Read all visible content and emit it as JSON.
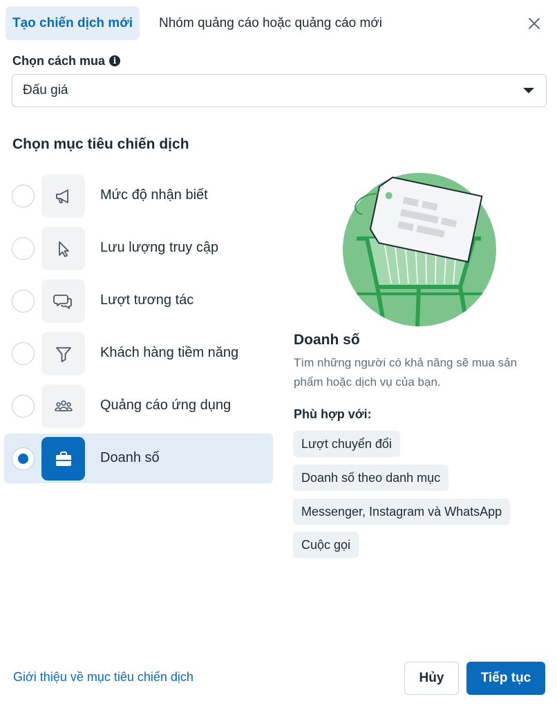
{
  "header": {
    "tabs": [
      {
        "label": "Tạo chiến dịch mới",
        "active": true
      },
      {
        "label": "Nhóm quảng cáo hoặc quảng cáo mới",
        "active": false
      }
    ],
    "close_icon": "close-icon"
  },
  "buying_type": {
    "label": "Chọn cách mua",
    "info_icon": "info-icon",
    "selected_value": "Đấu giá"
  },
  "objectives": {
    "heading": "Chọn mục tiêu chiến dịch",
    "items": [
      {
        "label": "Mức độ nhận biết",
        "icon": "megaphone-icon",
        "selected": false
      },
      {
        "label": "Lưu lượng truy cập",
        "icon": "cursor-icon",
        "selected": false
      },
      {
        "label": "Lượt tương tác",
        "icon": "chat-bubbles-icon",
        "selected": false
      },
      {
        "label": "Khách hàng tiềm năng",
        "icon": "funnel-icon",
        "selected": false
      },
      {
        "label": "Quảng cáo ứng dụng",
        "icon": "people-group-icon",
        "selected": false
      },
      {
        "label": "Doanh số",
        "icon": "shopping-bag-icon",
        "selected": true
      }
    ]
  },
  "detail": {
    "illustration": "shopping-cart-with-price-tag-illustration",
    "title": "Doanh số",
    "description": "Tìm những người có khả năng sẽ mua sản phẩm hoặc dịch vụ của bạn.",
    "fit_heading": "Phù hợp với:",
    "chips": [
      "Lượt chuyển đổi",
      "Doanh số theo danh mục",
      "Messenger, Instagram và WhatsApp",
      "Cuộc gọi"
    ]
  },
  "footer": {
    "learn_link": "Giới thiệu về mục tiêu chiến dịch",
    "cancel_label": "Hủy",
    "continue_label": "Tiếp tục"
  },
  "colors": {
    "accent": "#0a6bbd",
    "selected_row_bg": "#e2ecf6",
    "illustration_green": "#7cc48b"
  }
}
